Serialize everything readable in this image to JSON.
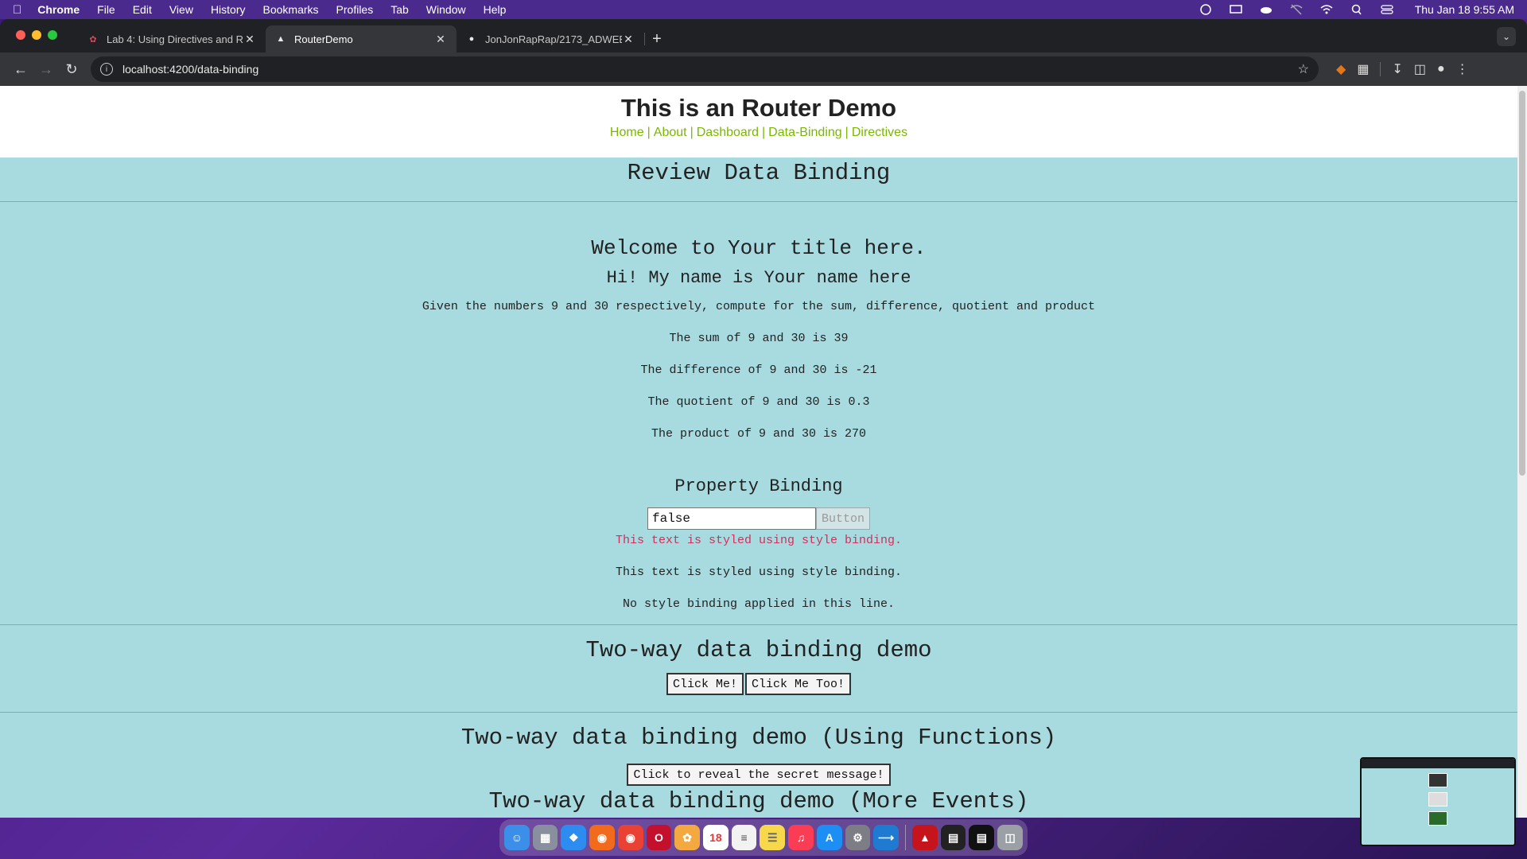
{
  "menubar": {
    "app": "Chrome",
    "items": [
      "File",
      "Edit",
      "View",
      "History",
      "Bookmarks",
      "Profiles",
      "Tab",
      "Window",
      "Help"
    ],
    "clock": "Thu Jan 18  9:55 AM"
  },
  "tabs": [
    {
      "title": "Lab 4: Using Directives and R",
      "favicon": "pdf-icon"
    },
    {
      "title": "RouterDemo",
      "favicon": "angular-icon"
    },
    {
      "title": "JonJonRapRap/2173_ADWEB",
      "favicon": "github-icon"
    }
  ],
  "toolbar": {
    "url": "localhost:4200/data-binding"
  },
  "site": {
    "title": "This is an Router Demo",
    "nav": [
      "Home",
      "About",
      "Dashboard",
      "Data-Binding",
      "Directives"
    ],
    "separator": "|"
  },
  "review": {
    "heading": "Review Data Binding"
  },
  "main": {
    "welcome": "Welcome to Your title here.",
    "hi": "Hi! My name is Your name here",
    "given": "Given the numbers 9 and 30 respectively, compute for the sum, difference, quotient and product",
    "sum": "The sum of 9 and 30 is 39",
    "difference": "The difference of 9 and 30 is -21",
    "quotient": "The quotient of 9 and 30 is 0.3",
    "product": "The product of 9 and 30 is 270"
  },
  "property_binding": {
    "title": "Property Binding",
    "input_value": "false",
    "button_label": "Button",
    "styled_red": "This text is styled using style binding.",
    "styled_plain": "This text is styled using style binding.",
    "no_style": "No style binding applied in this line."
  },
  "two_way": {
    "title": "Two-way data binding demo",
    "button1": "Click Me!",
    "button2": "Click Me Too!"
  },
  "two_way_fn": {
    "title": "Two-way data binding demo (Using Functions)",
    "button": "Click to reveal the secret message!",
    "more_title": "Two-way data binding demo (More Events)"
  },
  "colors": {
    "content_bg": "#a8dbe0",
    "nav_link": "#7ab800",
    "styled_red": "#d0305a"
  },
  "dock": {
    "calendar_day": "18"
  }
}
